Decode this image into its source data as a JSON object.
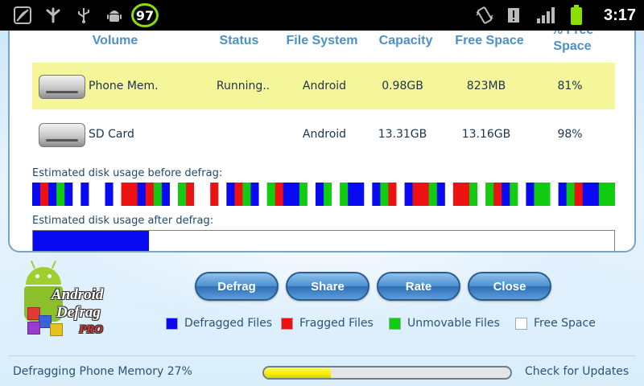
{
  "status_bar": {
    "icons": [
      "no-signal-icon",
      "usb-tether-icon",
      "usb-icon",
      "android-debug-icon",
      "vibrate-icon",
      "alert-icon",
      "signal-strength-icon",
      "battery-icon"
    ],
    "battery_level": "97",
    "time": "3:17"
  },
  "table": {
    "headers": [
      "Volume",
      "Status",
      "File System",
      "Capacity",
      "Free Space",
      "% Free Space"
    ],
    "rows": [
      {
        "volume": "Phone Mem.",
        "status": "Running..",
        "filesystem": "Android",
        "capacity": "0.98GB",
        "free": "823MB",
        "pct_free": "81%",
        "selected": true
      },
      {
        "volume": "SD Card",
        "status": "",
        "filesystem": "Android",
        "capacity": "13.31GB",
        "free": "13.16GB",
        "pct_free": "98%",
        "selected": false
      }
    ]
  },
  "disk_map": {
    "before_label": "Estimated disk usage before defrag:",
    "after_label": "Estimated disk usage after defrag:",
    "after_defragged_fraction": 0.2,
    "before_segments": [
      "B",
      "R",
      "B",
      "G",
      "B",
      "W",
      "B",
      "W",
      "W",
      "B",
      "W",
      "R",
      "R",
      "B",
      "R",
      "G",
      "B",
      "W",
      "G",
      "R",
      "W",
      "W",
      "R",
      "W",
      "B",
      "R",
      "G",
      "B",
      "W",
      "G",
      "R",
      "B",
      "B",
      "G",
      "W",
      "B",
      "G",
      "W",
      "G",
      "B",
      "B",
      "W",
      "B",
      "G",
      "R",
      "W",
      "B",
      "R",
      "R",
      "G",
      "B",
      "W",
      "R",
      "R",
      "G",
      "W",
      "G",
      "R",
      "B",
      "G",
      "W",
      "B",
      "G",
      "G",
      "W",
      "B",
      "G",
      "R",
      "B",
      "B",
      "G",
      "G"
    ]
  },
  "colors": {
    "defragged": "#0a0af2",
    "fragged": "#ee1111",
    "unmovable": "#11cc11",
    "free": "#ffffff"
  },
  "buttons": {
    "defrag": "Defrag",
    "share": "Share",
    "rate": "Rate",
    "close": "Close"
  },
  "legend": {
    "defragged": "Defragged Files",
    "fragged": "Fragged Files",
    "unmovable": "Unmovable Files",
    "free": "Free Space"
  },
  "logo": {
    "line1": "Android",
    "line2": "Defrag",
    "line3": "PRO"
  },
  "footer": {
    "status": "Defragging Phone Memory 27%",
    "progress": 0.27,
    "check_updates": "Check for Updates"
  }
}
